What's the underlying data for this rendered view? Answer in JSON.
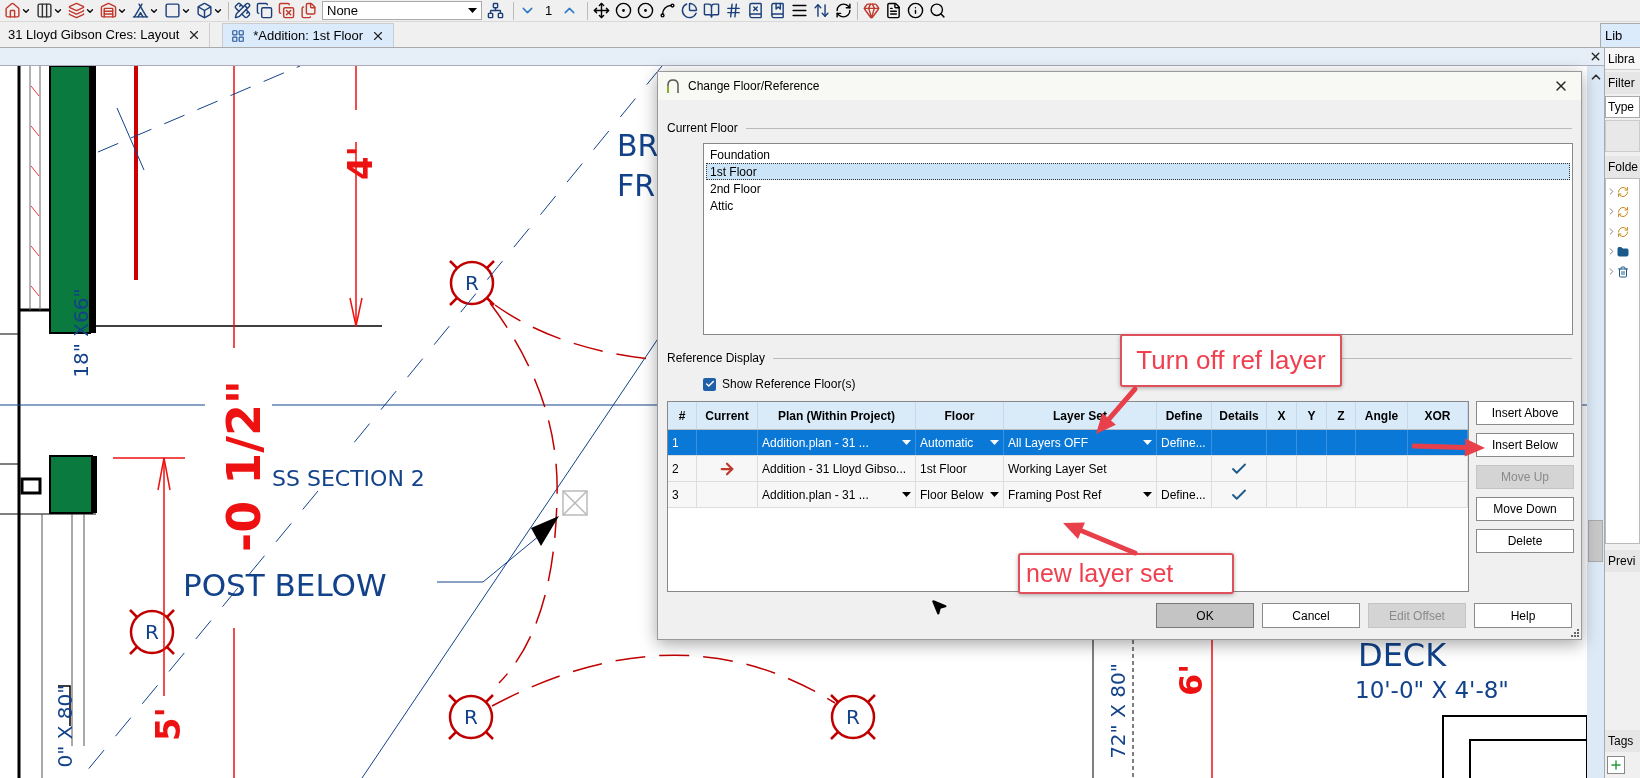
{
  "toolbar": {
    "layer_set_dropdown": "None",
    "floor_number": "1"
  },
  "tabs": [
    {
      "label": "31 Lloyd Gibson Cres: Layout",
      "selected": false
    },
    {
      "label": "*Addition: 1st Floor",
      "selected": true
    }
  ],
  "library_tab": "Lib",
  "library_panel": {
    "title": "Libra",
    "filter_label": "Filter",
    "search_field": {
      "placeholder": "Type"
    },
    "folders_label": "Folde",
    "preview_label": "Previ",
    "tags_label": "Tags"
  },
  "canvas": {
    "labels": [
      "BR",
      "FR",
      "4'",
      "18\" X66\"",
      "-0 1/2\"",
      "SS SECTION 2",
      "POST BELOW",
      "R",
      "R",
      "R",
      "R",
      "5'",
      "0\" X 80\"",
      "DECK",
      "10'-0\" X 4'-8\"",
      "72\" X 80\"",
      "6'"
    ]
  },
  "dialog": {
    "title": "Change Floor/Reference",
    "current_floor": {
      "label": "Current Floor",
      "floors": [
        {
          "name": "Foundation",
          "selected": false
        },
        {
          "name": "1st Floor",
          "selected": true
        },
        {
          "name": "2nd Floor",
          "selected": false
        },
        {
          "name": "Attic",
          "selected": false
        }
      ]
    },
    "reference_display": {
      "label": "Reference Display",
      "show_reference": {
        "label": "Show Reference Floor(s)",
        "checked": true
      }
    },
    "table": {
      "columns": [
        "#",
        "Current",
        "Plan (Within Project)",
        "Floor",
        "Layer Set",
        "Define",
        "Details",
        "X",
        "Y",
        "Z",
        "Angle",
        "XOR"
      ],
      "rows": [
        {
          "number": "1",
          "selected": true,
          "current": false,
          "editable": true,
          "plan": "Addition.plan - 31 ...",
          "floor": "Automatic",
          "layer_set": "All Layers OFF",
          "define": "Define...",
          "details": false
        },
        {
          "number": "2",
          "selected": false,
          "current": true,
          "editable": false,
          "plan": "Addition - 31 Lloyd Gibso...",
          "floor": "1st Floor",
          "layer_set": "Working Layer Set",
          "details": true
        },
        {
          "number": "3",
          "selected": false,
          "current": false,
          "editable": true,
          "plan": "Addition.plan - 31 ...",
          "floor": "Floor Below",
          "layer_set": "Framing Post Ref",
          "define": "Define...",
          "details": true
        }
      ]
    },
    "side_buttons": [
      {
        "label": "Insert Above",
        "disabled": false
      },
      {
        "label": "Insert Below",
        "disabled": false
      },
      {
        "label": "Move Up",
        "disabled": true
      },
      {
        "label": "Move Down",
        "disabled": false
      },
      {
        "label": "Delete",
        "disabled": false
      }
    ],
    "buttons": [
      {
        "label": "OK",
        "disabled": false,
        "default": true
      },
      {
        "label": "Cancel",
        "disabled": false,
        "default": false
      },
      {
        "label": "Edit Offset",
        "disabled": true,
        "default": false
      },
      {
        "label": "Help",
        "disabled": false,
        "default": false
      }
    ]
  },
  "annotations": [
    {
      "text": "Turn off ref layer"
    },
    {
      "text": "new layer set"
    }
  ]
}
